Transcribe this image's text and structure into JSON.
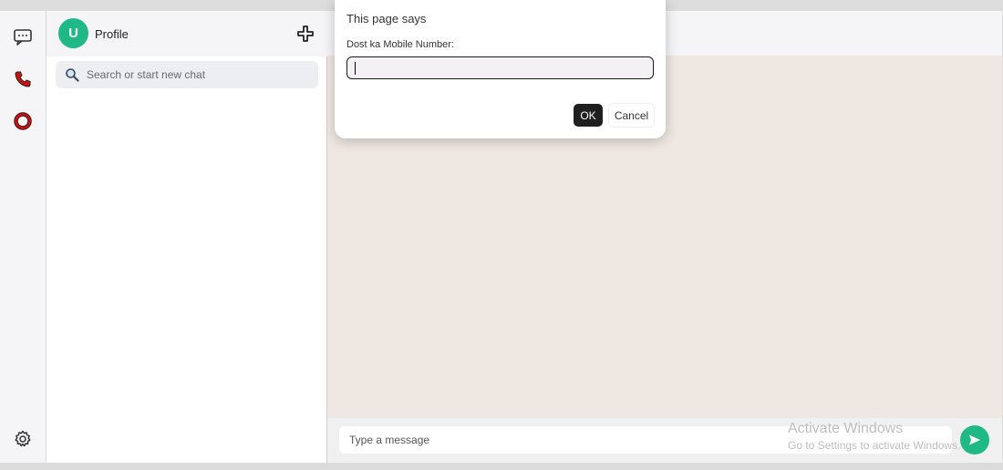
{
  "rail": {
    "icons": [
      "chat-icon",
      "phone-icon",
      "status-ring-icon",
      "gear-icon"
    ],
    "accent_color": "#d10f0f"
  },
  "sidebar": {
    "avatar_initial": "U",
    "avatar_color": "#1fb985",
    "profile_label": "Profile",
    "search_placeholder": "Search or start new chat"
  },
  "chat": {
    "message_placeholder": "Type a message",
    "send_icon": "send-arrow-icon",
    "background_color": "#efe7e2"
  },
  "dialog": {
    "title": "This page says",
    "label": "Dost ka Mobile Number:",
    "input_value": "",
    "ok_label": "OK",
    "cancel_label": "Cancel"
  },
  "watermark": {
    "title": "Activate Windows",
    "subtitle": "Go to Settings to activate Windows."
  }
}
